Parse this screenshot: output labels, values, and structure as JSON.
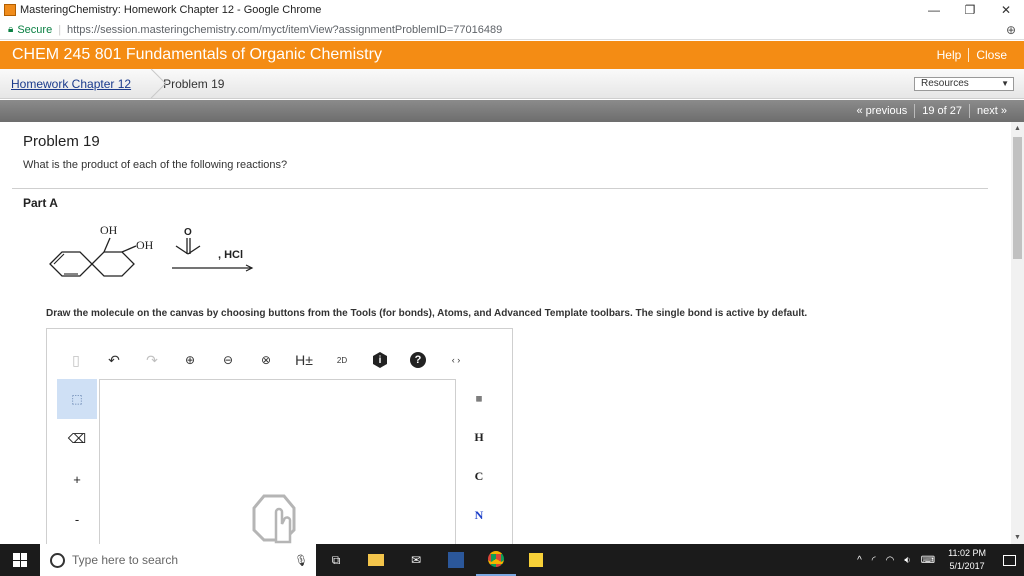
{
  "browser": {
    "tab_title": "MasteringChemistry: Homework Chapter 12 - Google Chrome",
    "secure_label": "Secure",
    "url": "https://session.masteringchemistry.com/myct/itemView?assignmentProblemID=77016489"
  },
  "header": {
    "course_title": "CHEM 245 801 Fundamentals of Organic Chemistry",
    "help_label": "Help",
    "close_label": "Close"
  },
  "breadcrumb": {
    "parent_label": "Homework Chapter 12",
    "current_label": "Problem 19",
    "resources_label": "Resources"
  },
  "nav": {
    "previous_label": "« previous",
    "position_label": "19 of 27",
    "next_label": "next »"
  },
  "problem": {
    "title": "Problem 19",
    "question": "What is the product of each of the following reactions?",
    "part_label": "Part A",
    "reagent_label": ", HCl",
    "oh_top": "OH",
    "oh_right": "OH",
    "o_label": "O",
    "instruction": "Draw the molecule on the canvas by choosing buttons from the Tools (for bonds), Atoms, and Advanced Template toolbars. The single bond is active by default."
  },
  "editor": {
    "tools": {
      "h_label": "H±",
      "twod_label": "2D",
      "info_label": "i",
      "help_label": "?"
    },
    "left_tools": {
      "plus_label": "+",
      "minus_label": "-"
    },
    "atoms": {
      "h": "H",
      "c": "C",
      "n": "N"
    }
  },
  "taskbar": {
    "search_placeholder": "Type here to search",
    "time": "11:02 PM",
    "date": "5/1/2017"
  },
  "colors": {
    "header_bg": "#f48c14",
    "nav_bg": "#777777",
    "active_tool_bg": "#cfe0f5",
    "taskbar_bg": "#1b1b1b"
  }
}
